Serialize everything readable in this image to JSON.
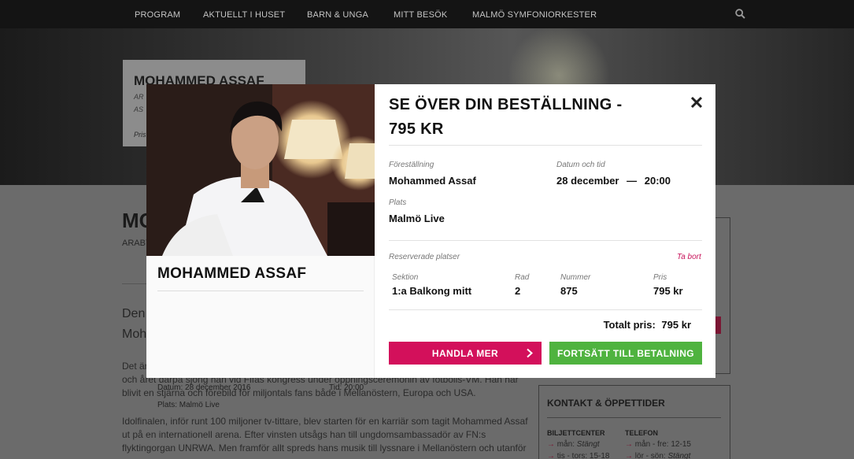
{
  "nav": {
    "items": [
      "PROGRAM",
      "AKTUELLT I HUSET",
      "BARN & UNGA",
      "MITT BESÖK",
      "MALMÖ SYMFONIORKESTER"
    ],
    "search_icon": "search-icon"
  },
  "hero": {
    "title": "MOHAMMED ASSAF",
    "subtitle_1": "AR",
    "subtitle_2": "AS",
    "price_label": "Pris"
  },
  "page": {
    "title": "MO",
    "subtitle": "ARABY",
    "lead_1": "Den",
    "lead_2": "Moh",
    "paragraphs": [
      "Det är",
      "och året därpå sjöng han vid Fifas kongress under öppningsceremonin av fotbolls-VM. Han har",
      "blivit en stjärna och förebild för miljontals fans både i Mellanöstern, Europa och USA.",
      "Idolfinalen, inför runt 100 miljoner tv-tittare, blev starten för en karriär som tagit Mohammed Assaf",
      "ut på en internationell arena. Efter vinsten utsågs han till ungdomsambassadör av FN:s",
      "flyktingorgan UNRWA. Men framför allt spreds hans musik till lyssnare i Mellanöstern och utanför"
    ]
  },
  "sidebar": {
    "contact_title": "KONTAKT & ÖPPETTIDER",
    "col1_heading": "BILJETTCENTER",
    "col1_rows": [
      {
        "days": "mån:",
        "hours": "Stängt"
      },
      {
        "days": "tis - tors:",
        "hours": "15-18"
      }
    ],
    "col2_heading": "TELEFON",
    "col2_rows": [
      {
        "days": "mån - fre:",
        "hours": "12-15"
      },
      {
        "days": "lör - sön:",
        "hours": "Stängt"
      }
    ]
  },
  "modal": {
    "title": "SE ÖVER DIN BESTÄLLNING - 795 KR",
    "close_icon": "close-icon",
    "artist": "MOHAMMED ASSAF",
    "date_line": "Datum: 28 december 2016",
    "time_line": "Tid: 20:00",
    "venue_line": "Plats: Malmö Live",
    "show_label": "Föreställning",
    "show_value": "Mohammed Assaf",
    "datetime_label": "Datum och tid",
    "date_value": "28 december",
    "datetime_sep": "—",
    "time_value": "20:00",
    "venue_label": "Plats",
    "venue_value": "Malmö Live",
    "reserved_label": "Reserverade platser",
    "remove_link": "Ta bort",
    "seat": {
      "section_label": "Sektion",
      "section_value": "1:a Balkong mitt",
      "row_label": "Rad",
      "row_value": "2",
      "number_label": "Nummer",
      "number_value": "875",
      "price_label": "Pris",
      "price_value": "795 kr"
    },
    "total_label": "Totalt pris:",
    "total_value": "795 kr",
    "shop_more_button": "HANDLA MER",
    "checkout_button": "FORTSÄTT TILL BETALNING"
  },
  "colors": {
    "accent_pink": "#d3105b",
    "accent_green": "#4fb33f",
    "nav_bg": "#141414"
  }
}
